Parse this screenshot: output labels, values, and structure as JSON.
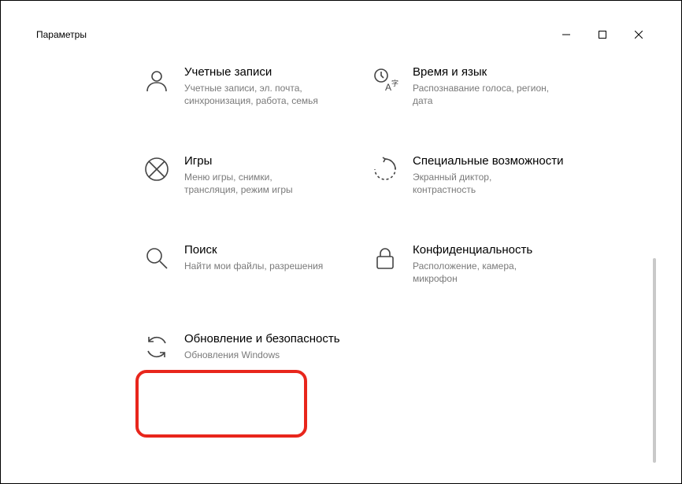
{
  "window": {
    "title": "Параметры"
  },
  "tiles": {
    "accounts": {
      "title": "Учетные записи",
      "desc": "Учетные записи, эл. почта, синхронизация, работа, семья"
    },
    "time": {
      "title": "Время и язык",
      "desc": "Распознавание голоса, регион, дата"
    },
    "gaming": {
      "title": "Игры",
      "desc": "Меню игры, снимки, трансляция, режим игры"
    },
    "ease": {
      "title": "Специальные возможности",
      "desc": "Экранный диктор, контрастность"
    },
    "search": {
      "title": "Поиск",
      "desc": "Найти мои файлы, разрешения"
    },
    "privacy": {
      "title": "Конфиденциальность",
      "desc": "Расположение, камера, микрофон"
    },
    "update": {
      "title": "Обновление и безопасность",
      "desc": "Обновления Windows"
    }
  }
}
